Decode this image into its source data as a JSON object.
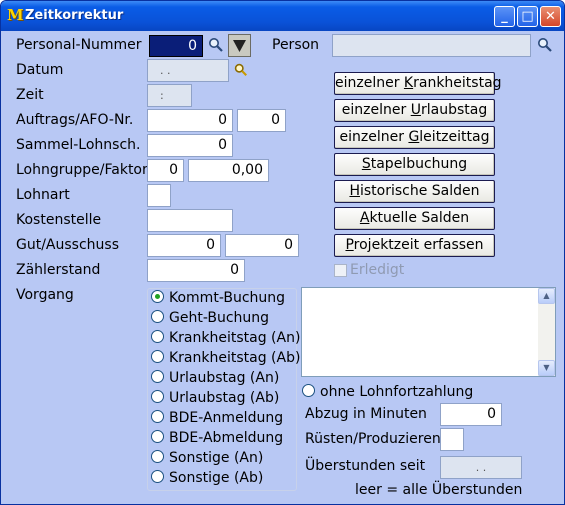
{
  "window": {
    "title": "Zeitkorrektur",
    "app_icon": "M",
    "minimize": "_",
    "maximize": "□",
    "close": "✕"
  },
  "labels": {
    "personal_nummer": "Personal-Nummer",
    "person": "Person",
    "datum": "Datum",
    "zeit": "Zeit",
    "auftrags": "Auftrags/AFO-Nr.",
    "sammel": "Sammel-Lohnsch.",
    "lohngruppe": "Lohngruppe/Faktor",
    "lohnart": "Lohnart",
    "kostenstelle": "Kostenstelle",
    "gut_ausschuss": "Gut/Ausschuss",
    "zaehlerstand": "Zählerstand",
    "vorgang": "Vorgang"
  },
  "fields": {
    "personal_nummer": "0",
    "person": "",
    "datum": ". .",
    "zeit": ":",
    "auftrags_nr": "0",
    "afo_nr": "0",
    "sammel": "0",
    "lohngruppe": "0",
    "faktor": "0,00",
    "lohnart": "",
    "kostenstelle": "",
    "gut": "0",
    "ausschuss": "0",
    "zaehlerstand": "0"
  },
  "buttons": [
    {
      "pre": "einzelner ",
      "ul": "K",
      "post": "rankheitstag"
    },
    {
      "pre": "einzelner ",
      "ul": "U",
      "post": "rlaubstag"
    },
    {
      "pre": "einzelner ",
      "ul": "G",
      "post": "leitzeittag"
    },
    {
      "pre": "",
      "ul": "S",
      "post": "tapelbuchung"
    },
    {
      "pre": "",
      "ul": "H",
      "post": "istorische Salden"
    },
    {
      "pre": "",
      "ul": "A",
      "post": "ktuelle Salden"
    },
    {
      "pre": "",
      "ul": "P",
      "post": "rojektzeit erfassen"
    }
  ],
  "erledigt": "Erledigt",
  "vorgang_options": [
    {
      "label": "Kommt-Buchung",
      "selected": true
    },
    {
      "label": "Geht-Buchung",
      "selected": false
    },
    {
      "label": "Krankheitstag (An)",
      "selected": false
    },
    {
      "label": "Krankheitstag (Ab)",
      "selected": false
    },
    {
      "label": "Urlaubstag (An)",
      "selected": false
    },
    {
      "label": "Urlaubstag (Ab)",
      "selected": false
    },
    {
      "label": "BDE-Anmeldung",
      "selected": false
    },
    {
      "label": "BDE-Abmeldung",
      "selected": false
    },
    {
      "label": "Sonstige (An)",
      "selected": false
    },
    {
      "label": "Sonstige (Ab)",
      "selected": false
    }
  ],
  "ohne_lohnfortzahlung": "ohne Lohnfortzahlung",
  "abzug_label": "Abzug in Minuten",
  "abzug_value": "0",
  "ruesten_label": "Rüsten/Produzieren",
  "ueberstunden_label": "Überstunden seit",
  "ueberstunden_value": ". .",
  "ueberstunden_hint": "leer = alle Überstunden",
  "colors": {
    "titlebar": "#0a52d8",
    "window_bg": "#b8c8f4",
    "selected_field": "#0a1e78"
  }
}
